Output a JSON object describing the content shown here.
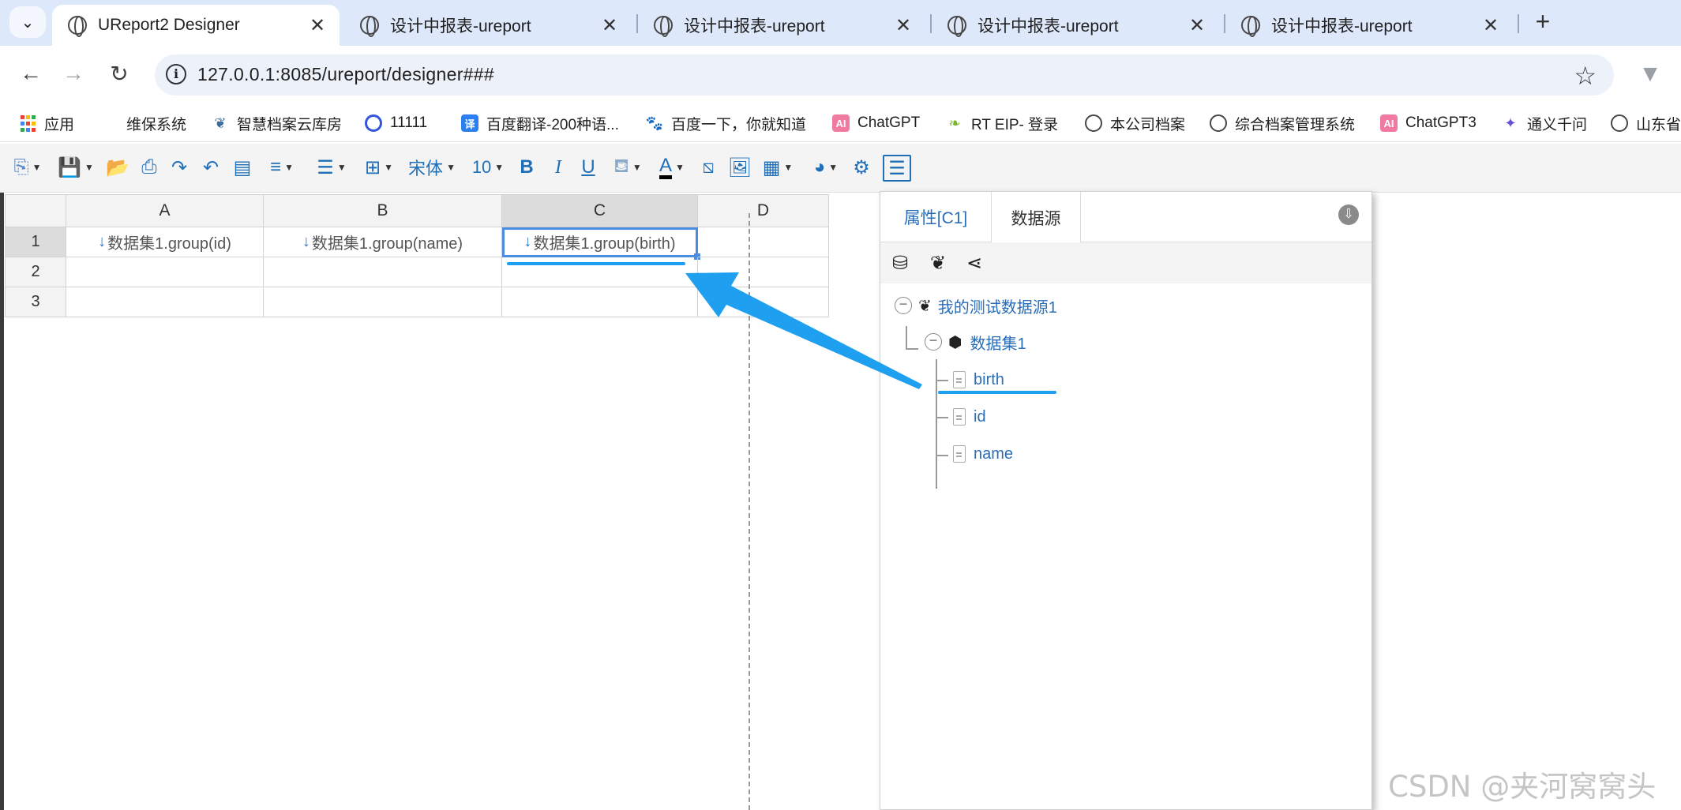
{
  "browser": {
    "tabs": [
      {
        "title": "UReport2 Designer",
        "active": true
      },
      {
        "title": "设计中报表-ureport",
        "active": false
      },
      {
        "title": "设计中报表-ureport",
        "active": false
      },
      {
        "title": "设计中报表-ureport",
        "active": false
      },
      {
        "title": "设计中报表-ureport",
        "active": false
      }
    ],
    "url": "127.0.0.1:8085/ureport/designer###",
    "bookmarks": [
      {
        "label": "应用",
        "icon": "apps-icon"
      },
      {
        "label": "维保系统",
        "icon": "none"
      },
      {
        "label": "智慧档案云库房",
        "icon": "leaf-logo-icon"
      },
      {
        "label": "11111",
        "icon": "search-logo-icon"
      },
      {
        "label": "百度翻译-200种语...",
        "icon": "translate-icon",
        "glyph": "译"
      },
      {
        "label": "百度一下，你就知道",
        "icon": "baidu-paw-icon"
      },
      {
        "label": "ChatGPT",
        "icon": "ai-icon",
        "glyph": "AI"
      },
      {
        "label": "RT EIP- 登录",
        "icon": "leaf-icon"
      },
      {
        "label": "本公司档案",
        "icon": "globe-icon"
      },
      {
        "label": "综合档案管理系统",
        "icon": "globe-icon"
      },
      {
        "label": "ChatGPT3",
        "icon": "ai-icon",
        "glyph": "AI"
      },
      {
        "label": "通义千问",
        "icon": "tongyi-icon"
      },
      {
        "label": "山东省",
        "icon": "globe-icon"
      }
    ]
  },
  "designer": {
    "toolbar": {
      "font_name": "宋体",
      "font_size": "10",
      "bold_label": "B",
      "italic_label": "I",
      "underline_label": "U",
      "font_color_label": "A"
    },
    "sheet": {
      "columns": [
        "A",
        "B",
        "C",
        "D"
      ],
      "rows": [
        "1",
        "2",
        "3"
      ],
      "cells": {
        "A1": "数据集1.group(id)",
        "B1": "数据集1.group(name)",
        "C1": "数据集1.group(birth)"
      },
      "selected_cell": "C1"
    },
    "panel": {
      "tabs": [
        "属性[C1]",
        "数据源"
      ],
      "active_tab": "数据源",
      "tree": {
        "datasource": "我的测试数据源1",
        "dataset": "数据集1",
        "fields": [
          "birth",
          "id",
          "name"
        ]
      }
    }
  },
  "watermark": "CSDN @夹河窝窝头",
  "colors": {
    "accent": "#1f9fef",
    "link": "#2a6db8",
    "toolbar_icon": "#1f6fb8"
  }
}
